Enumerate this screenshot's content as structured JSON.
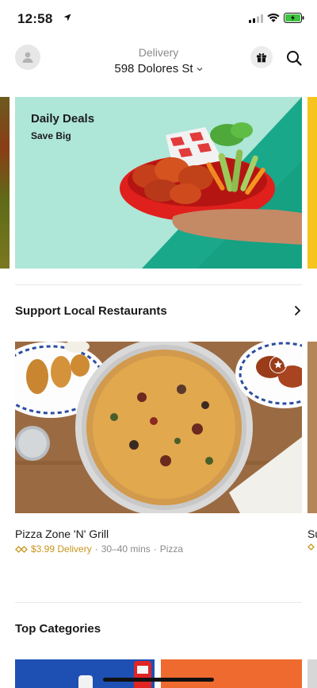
{
  "status_bar": {
    "time": "12:58"
  },
  "header": {
    "mode_label": "Delivery",
    "address": "598 Dolores St",
    "icons": [
      "avatar-icon",
      "gift-icon",
      "search-icon",
      "chevron-down-icon"
    ]
  },
  "banner": {
    "title": "Daily Deals",
    "subtitle": "Save Big",
    "colors": {
      "background": "#aee6d8",
      "accent": "#1aa88a"
    }
  },
  "sections": [
    {
      "title": "Support Local Restaurants",
      "stores": [
        {
          "name": "Pizza Zone 'N' Grill",
          "delivery_fee": "$3.99 Delivery",
          "eta": "30–40 mins",
          "cuisine": "Pizza"
        },
        {
          "name": "Su"
        }
      ]
    },
    {
      "title": "Top Categories"
    }
  ],
  "colors": {
    "fee": "#c8941c",
    "text": "#191919",
    "muted": "#8a8a8a"
  }
}
